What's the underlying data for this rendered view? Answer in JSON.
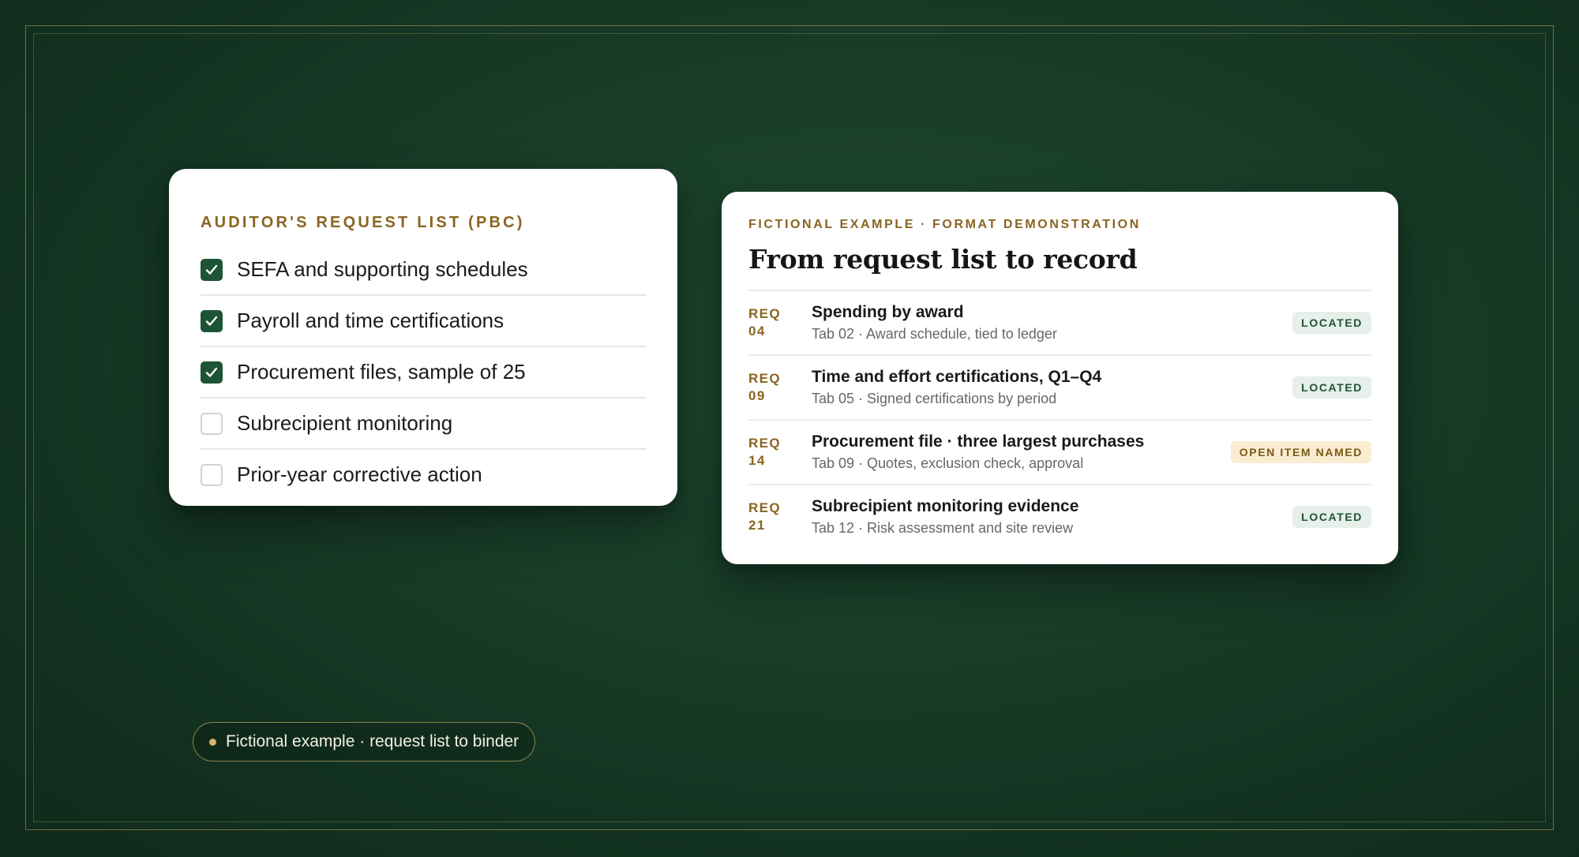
{
  "colors": {
    "background": "#163a26",
    "accent_gold": "#8a6420",
    "check_green": "#1d5436",
    "located_badge_bg": "#e6efe9",
    "open_badge_bg": "#f9ecd1"
  },
  "pbc_card": {
    "title": "AUDITOR'S REQUEST LIST (PBC)",
    "items": [
      {
        "label": "SEFA and supporting schedules",
        "checked": true
      },
      {
        "label": "Payroll and time certifications",
        "checked": true
      },
      {
        "label": "Procurement files, sample of 25",
        "checked": true
      },
      {
        "label": "Subrecipient monitoring",
        "checked": false
      },
      {
        "label": "Prior-year corrective action",
        "checked": false
      }
    ]
  },
  "record_card": {
    "eyebrow": "FICTIONAL EXAMPLE · FORMAT DEMONSTRATION",
    "title": "From request list to record",
    "rows": [
      {
        "req_label": "REQ",
        "req_num": "04",
        "name": "Spending by award",
        "detail": "Tab 02 · Award schedule, tied to ledger",
        "status": "LOCATED",
        "status_type": "located"
      },
      {
        "req_label": "REQ",
        "req_num": "09",
        "name": "Time and effort certifications, Q1–Q4",
        "detail": "Tab 05 · Signed certifications by period",
        "status": "LOCATED",
        "status_type": "located"
      },
      {
        "req_label": "REQ",
        "req_num": "14",
        "name": "Procurement file · three largest purchases",
        "detail": "Tab 09 · Quotes, exclusion check, approval",
        "status": "OPEN ITEM NAMED",
        "status_type": "open"
      },
      {
        "req_label": "REQ",
        "req_num": "21",
        "name": "Subrecipient monitoring evidence",
        "detail": "Tab 12 · Risk assessment and site review",
        "status": "LOCATED",
        "status_type": "located"
      }
    ]
  },
  "caption": {
    "text": "Fictional example · request list to binder"
  }
}
